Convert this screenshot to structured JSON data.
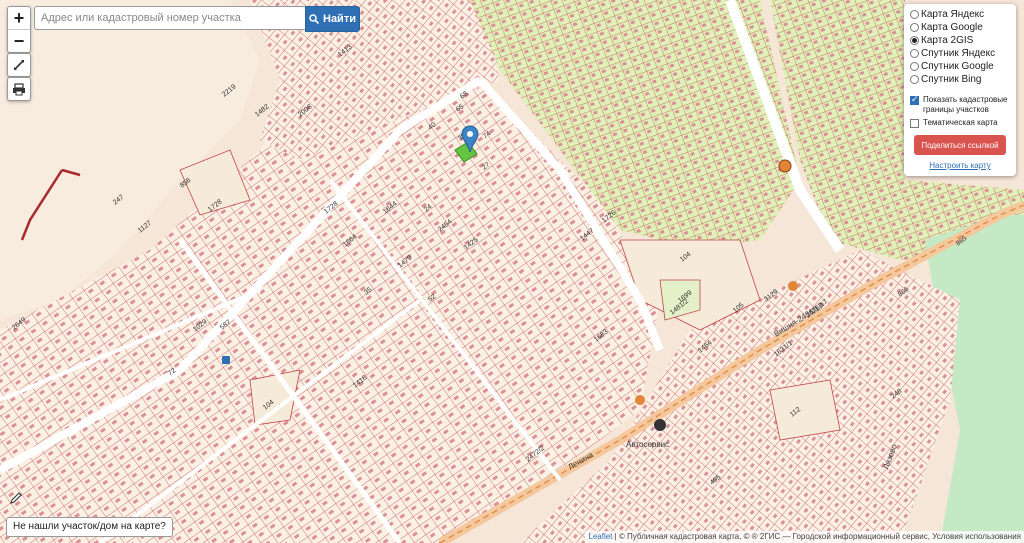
{
  "search": {
    "placeholder": "Адрес или кадастровый номер участка",
    "button_label": "Найти"
  },
  "zoom": {
    "plus": "+",
    "minus": "−"
  },
  "layers": {
    "options": [
      {
        "label": "Карта Яндекс",
        "selected": false
      },
      {
        "label": "Карта Google",
        "selected": false
      },
      {
        "label": "Карта 2GIS",
        "selected": true
      },
      {
        "label": "Спутник Яндекс",
        "selected": false
      },
      {
        "label": "Спутник Google",
        "selected": false
      },
      {
        "label": "Спутник Bing",
        "selected": false
      }
    ],
    "show_borders_line1": "Показать кадастровые",
    "show_borders_line2": "границы участков",
    "show_borders_checked": true,
    "thematic_label": "Тематическая карта",
    "thematic_checked": false,
    "share_label": "Поделиться ссылкой",
    "configure_label": "Настроить карту"
  },
  "not_found_label": "Не нашли участок/дом на карте?",
  "attribution": {
    "leaflet": "Leaflet",
    "text": "| © Публичная кадастровая карта, © ® 2ГИС — Городской информационный сервис, Условия использования"
  },
  "map": {
    "parcel_labels": [
      "1413",
      "856",
      "247",
      "1127",
      "2219",
      "1482",
      "2008",
      "2649",
      "104",
      "1699",
      "1481/2",
      "105",
      "865",
      "866",
      "248",
      "112",
      "495",
      "1029",
      "587",
      "72",
      "65",
      "74",
      "68",
      "104",
      "1416",
      "1447",
      "1726",
      "1683",
      "1631/1",
      "3129",
      "2472/2",
      "2436/17",
      "1464",
      "52",
      "35",
      "24",
      "27",
      "39",
      "40",
      "1479",
      "1664",
      "1728",
      "1728",
      "1644",
      "1425",
      "2454"
    ],
    "street_labels": [
      "Вишня-2436/17",
      "Лязово",
      "Ленина"
    ],
    "place_labels": [
      "Автосервис"
    ],
    "colors": {
      "background": "#f6e6d8",
      "parcel_fill": "#fbf0e4",
      "parcel_stroke": "#c2454a",
      "building": "#dc8f97",
      "garden_fill": "#dff0b8",
      "road": "#ffffff",
      "main_road": "#f4c79d",
      "railway": "#c6e6c2",
      "water_green": "#c5e9c4",
      "marker": "#3c84c8",
      "highlight": "#63c542"
    }
  }
}
